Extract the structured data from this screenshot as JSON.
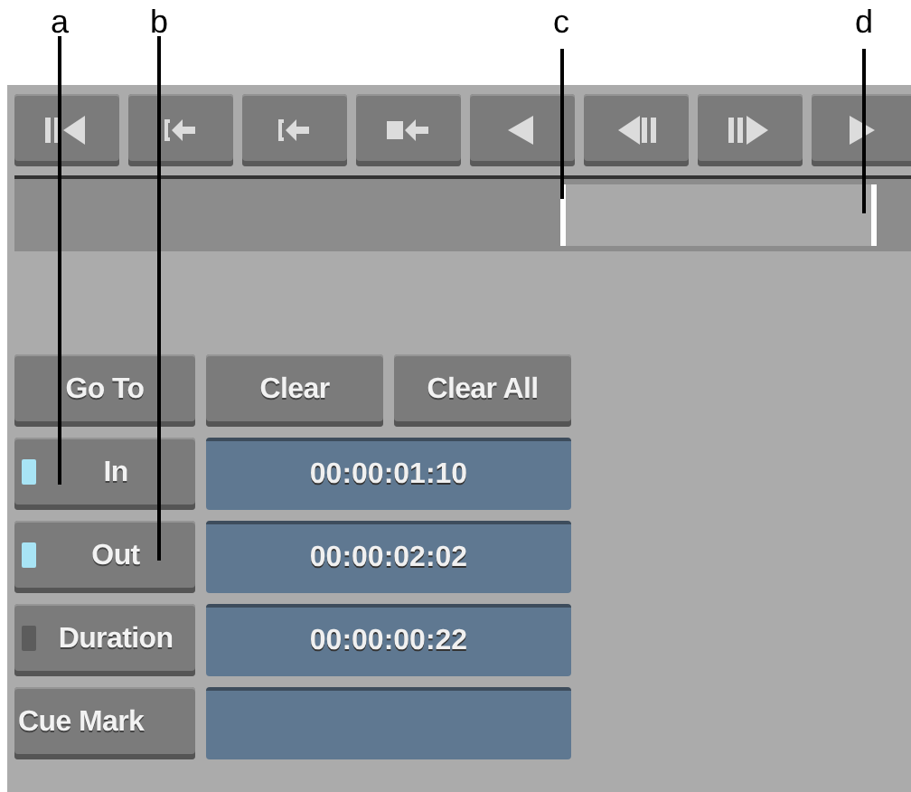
{
  "callouts": [
    "a",
    "b",
    "c",
    "d"
  ],
  "mark_buttons": [
    {
      "label": "Go To"
    },
    {
      "label": "Clear"
    },
    {
      "label": "Clear All"
    }
  ],
  "rows": [
    {
      "kind": "indicator",
      "label": "In",
      "lit": true,
      "value": "00:00:01:10"
    },
    {
      "kind": "indicator",
      "label": "Out",
      "lit": true,
      "value": "00:00:02:02"
    },
    {
      "kind": "indicator",
      "label": "Duration",
      "lit": false,
      "value": "00:00:00:22"
    },
    {
      "kind": "plain",
      "label": "Cue Mark"
    }
  ]
}
